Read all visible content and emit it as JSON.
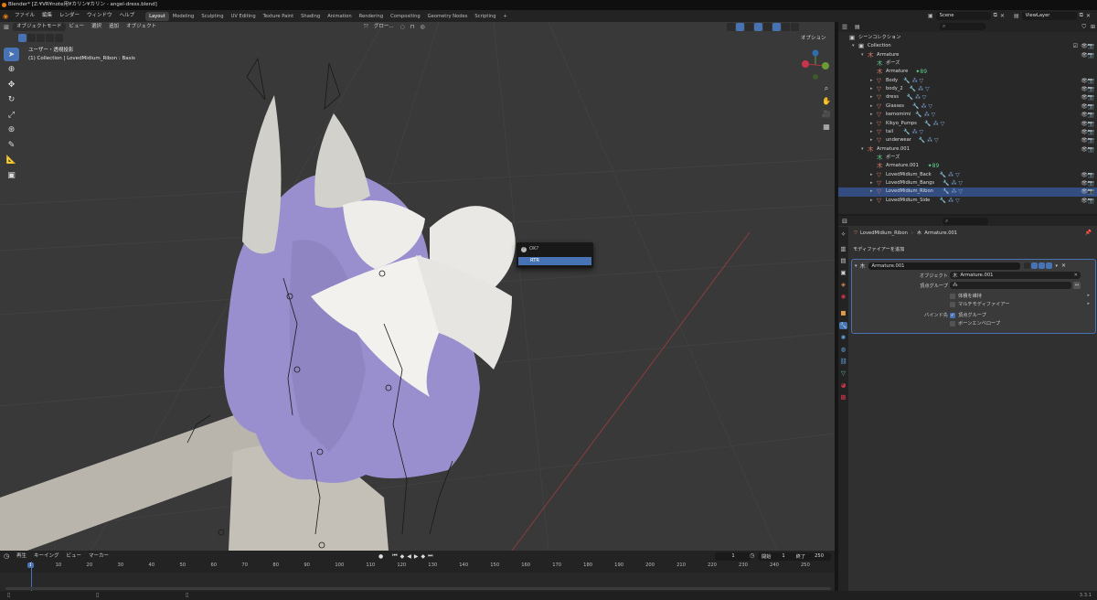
{
  "title_bar": {
    "text": "Blender* [Z:¥VR¥note用¥カリン¥カリン - angel-dress.blend]"
  },
  "menus": [
    "ファイル",
    "編集",
    "レンダー",
    "ウィンドウ",
    "ヘルプ"
  ],
  "workspaces": [
    "Layout",
    "Modeling",
    "Sculpting",
    "UV Editing",
    "Texture Paint",
    "Shading",
    "Animation",
    "Rendering",
    "Compositing",
    "Geometry Nodes",
    "Scripting",
    "+"
  ],
  "active_workspace": "Layout",
  "scene": {
    "name": "Scene",
    "view_layer": "ViewLayer"
  },
  "viewport": {
    "mode": "オブジェクトモード",
    "menus": [
      "ビュー",
      "選択",
      "追加",
      "オブジェクト"
    ],
    "transform": "グロー...",
    "options": "オプション",
    "view_name": "ユーザー・透視投影",
    "info": "(1) Collection | LovedMidium_Ribon : Basis"
  },
  "popup": {
    "question": "OK?",
    "button": "RTR"
  },
  "outliner": {
    "search_placeholder": "",
    "rows": [
      {
        "depth": 0,
        "caret": "",
        "icon": "coll",
        "name": "シーンコレクション",
        "mods": "",
        "vis": false
      },
      {
        "depth": 1,
        "caret": "▾",
        "icon": "coll",
        "name": "Collection",
        "mods": "",
        "vis": false,
        "check": true
      },
      {
        "depth": 2,
        "caret": "▾",
        "icon": "arm",
        "name": "Armature",
        "mods": "",
        "vis": true
      },
      {
        "depth": 3,
        "caret": "",
        "icon": "pose",
        "name": "ポーズ",
        "mods": "",
        "vis": false
      },
      {
        "depth": 3,
        "caret": "",
        "icon": "arm",
        "name": "Armature",
        "mods": "✦89",
        "vis": false
      },
      {
        "depth": 3,
        "caret": "▸",
        "icon": "mesh",
        "name": "Body",
        "mods": "🔧 ⁂ ▽",
        "vis": true
      },
      {
        "depth": 3,
        "caret": "▸",
        "icon": "mesh",
        "name": "body_2",
        "mods": "🔧 ⁂ ▽",
        "vis": true
      },
      {
        "depth": 3,
        "caret": "▸",
        "icon": "mesh",
        "name": "dress",
        "mods": "🔧 ⁂ ▽",
        "vis": true
      },
      {
        "depth": 3,
        "caret": "▸",
        "icon": "mesh",
        "name": "Glasses",
        "mods": "🔧 ⁂ ▽",
        "vis": true
      },
      {
        "depth": 3,
        "caret": "▸",
        "icon": "mesh",
        "name": "kemomimi",
        "mods": "🔧 ⁂ ▽",
        "vis": true
      },
      {
        "depth": 3,
        "caret": "▸",
        "icon": "mesh",
        "name": "Kikyo_Pumps",
        "mods": "🔧 ⁂ ▽",
        "vis": true
      },
      {
        "depth": 3,
        "caret": "▸",
        "icon": "mesh",
        "name": "tail",
        "mods": "🔧 ⁂ ▽",
        "vis": true
      },
      {
        "depth": 3,
        "caret": "▸",
        "icon": "mesh",
        "name": "underwear",
        "mods": "🔧 ⁂ ▽",
        "vis": true
      },
      {
        "depth": 2,
        "caret": "▾",
        "icon": "arm",
        "name": "Armature.001",
        "mods": "",
        "vis": true
      },
      {
        "depth": 3,
        "caret": "",
        "icon": "pose",
        "name": "ポーズ",
        "mods": "",
        "vis": false
      },
      {
        "depth": 3,
        "caret": "",
        "icon": "arm",
        "name": "Armature.001",
        "mods": "✦89",
        "vis": false
      },
      {
        "depth": 3,
        "caret": "▸",
        "icon": "mesh",
        "name": "LovedMidium_Back",
        "mods": "🔧 ⁂ ▽",
        "vis": true
      },
      {
        "depth": 3,
        "caret": "▸",
        "icon": "mesh",
        "name": "LovedMidium_Bangs",
        "mods": "🔧 ⁂ ▽",
        "vis": true
      },
      {
        "depth": 3,
        "caret": "▸",
        "icon": "mesh",
        "name": "LovedMidium_Ribon",
        "mods": "🔧 ⁂ ▽",
        "vis": true,
        "selected": true
      },
      {
        "depth": 3,
        "caret": "▸",
        "icon": "mesh",
        "name": "LovedMidium_Side",
        "mods": "🔧 ⁂ ▽",
        "vis": true
      }
    ]
  },
  "properties": {
    "breadcrumb_object": "LovedMidium_Ribon",
    "breadcrumb_modifier": "Armature.001",
    "add_modifier": "モディファイアーを追加",
    "modifier_name": "Armature.001",
    "object_label": "オブジェクト",
    "object_value": "Armature.001",
    "vertex_group_label": "頂点グループ",
    "preserve_volume": "体積を維持",
    "multi_modifier": "マルチモディファイアー",
    "bind_to_label": "バインド先",
    "bind_vertex_groups": "頂点グループ",
    "bind_bone_envelopes": "ボーンエンベロープ"
  },
  "timeline": {
    "menus": [
      "再生",
      "キーイング",
      "ビュー",
      "マーカー"
    ],
    "current_frame": "1",
    "start_label": "開始",
    "start": "1",
    "end_label": "終了",
    "end": "250",
    "ticks": [
      "1",
      "10",
      "20",
      "30",
      "40",
      "50",
      "60",
      "70",
      "80",
      "90",
      "100",
      "110",
      "120",
      "130",
      "140",
      "150",
      "160",
      "170",
      "180",
      "190",
      "200",
      "210",
      "220",
      "230",
      "240",
      "250"
    ]
  },
  "status": {
    "version": "3.3.1"
  },
  "colors": {
    "accent": "#4772b3",
    "hair": "#9a8fce",
    "popup_bg": "#181818"
  }
}
